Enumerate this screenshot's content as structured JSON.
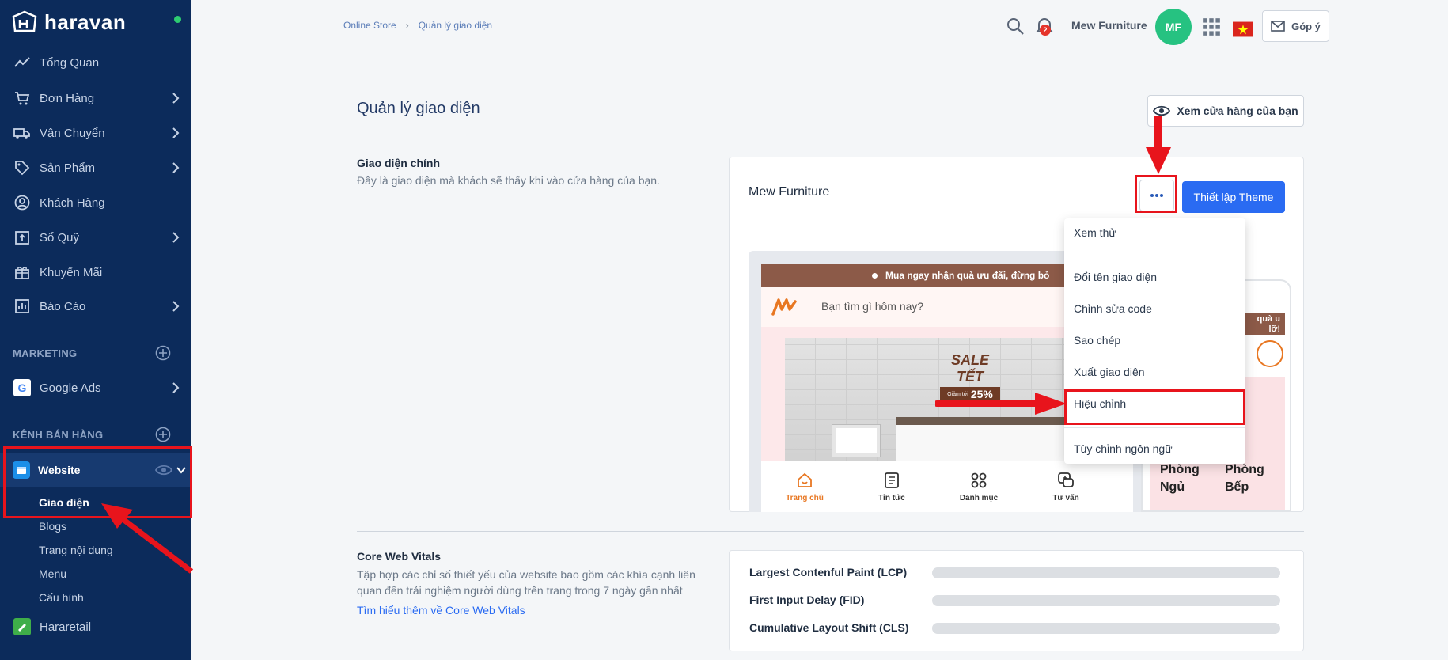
{
  "brand": {
    "name": "haravan"
  },
  "sidebar": {
    "items": [
      {
        "label": "Tổng Quan",
        "icon": "chart-line-icon",
        "has_chevron": false
      },
      {
        "label": "Đơn Hàng",
        "icon": "cart-icon",
        "has_chevron": true
      },
      {
        "label": "Vận Chuyển",
        "icon": "truck-icon",
        "has_chevron": true
      },
      {
        "label": "Sản Phẩm",
        "icon": "tag-icon",
        "has_chevron": true
      },
      {
        "label": "Khách Hàng",
        "icon": "user-circle-icon",
        "has_chevron": false
      },
      {
        "label": "Sổ Quỹ",
        "icon": "cashbox-icon",
        "has_chevron": true
      },
      {
        "label": "Khuyến Mãi",
        "icon": "gift-icon",
        "has_chevron": false
      },
      {
        "label": "Báo Cáo",
        "icon": "report-icon",
        "has_chevron": true
      }
    ],
    "marketing_title": "MARKETING",
    "google_ads": "Google Ads",
    "sales_channel_title": "KÊNH BÁN HÀNG",
    "website": "Website",
    "website_sub": [
      "Giao diện",
      "Blogs",
      "Trang nội dung",
      "Menu",
      "Cấu hình"
    ],
    "hararetail": "Hararetail"
  },
  "topbar": {
    "breadcrumb": [
      "Online Store",
      "Quản lý giao diện"
    ],
    "notification_count": "2",
    "store_name": "Mew Furniture",
    "avatar_initials": "MF",
    "feedback_label": "Góp ý"
  },
  "main": {
    "page_title": "Quản lý giao diện",
    "view_store_label": "Xem cửa hàng của bạn",
    "theme_section_title": "Giao diện chính",
    "theme_section_desc": "Đây là giao diện mà khách sẽ thấy khi vào cửa hàng của bạn.",
    "theme_name": "Mew Furniture",
    "setup_theme_label": "Thiết lập Theme",
    "preview": {
      "promo_text": "Mua ngay nhận quà ưu đãi, đừng bỏ",
      "search_placeholder": "Bạn tìm gì hôm nay?",
      "sale_title": "SALE TẾT",
      "sale_small": "Giảm tới",
      "sale_percent": "25%",
      "nav": [
        "Trang chủ",
        "Tin tức",
        "Danh mục",
        "Tư vấn"
      ],
      "mobile_promo": "quà u\nlỡ!",
      "mobile_cat_1": "Phòng\nNgủ",
      "mobile_cat_2": "Phòng\nBếp"
    },
    "dropdown": [
      "Xem thử",
      "Đổi tên giao diện",
      "Chỉnh sửa code",
      "Sao chép",
      "Xuất giao diện",
      "Hiệu chỉnh",
      "Tùy chỉnh ngôn ngữ"
    ],
    "cwv_title": "Core Web Vitals",
    "cwv_desc": "Tập hợp các chỉ số thiết yếu của website bao gồm các khía cạnh liên quan đến trải nghiệm người dùng trên trang trong 7 ngày gần nhất",
    "cwv_link": "Tìm hiểu thêm về Core Web Vitals",
    "metrics": [
      "Largest Contenful Paint (LCP)",
      "First Input Delay (FID)",
      "Cumulative Layout Shift (CLS)"
    ]
  },
  "colors": {
    "sidebar_bg": "#0c2b5b",
    "accent": "#2a6bf2",
    "annotation_red": "#e8141c",
    "avatar": "#26c281"
  }
}
